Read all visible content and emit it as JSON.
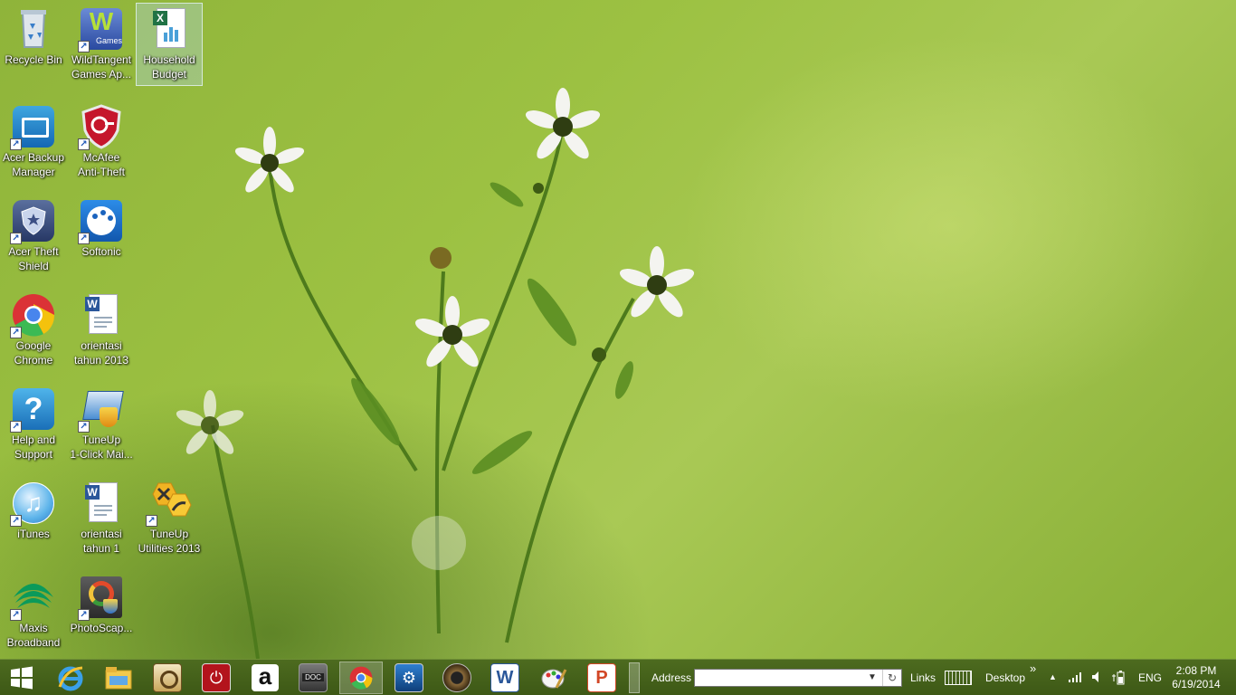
{
  "desktop": {
    "icons": [
      {
        "line1": "Recycle Bin",
        "line2": ""
      },
      {
        "line1": "WildTangent",
        "line2": "Games Ap..."
      },
      {
        "line1": "Household",
        "line2": "Budget"
      },
      {
        "line1": "Acer Backup",
        "line2": "Manager"
      },
      {
        "line1": "McAfee",
        "line2": "Anti-Theft"
      },
      {
        "line1": "Acer Theft",
        "line2": "Shield"
      },
      {
        "line1": "Softonic",
        "line2": ""
      },
      {
        "line1": "Google",
        "line2": "Chrome"
      },
      {
        "line1": "orientasi",
        "line2": "tahun 2013"
      },
      {
        "line1": "Help and",
        "line2": "Support"
      },
      {
        "line1": "TuneUp",
        "line2": "1-Click Mai..."
      },
      {
        "line1": "iTunes",
        "line2": ""
      },
      {
        "line1": "orientasi",
        "line2": "tahun 1"
      },
      {
        "line1": "TuneUp",
        "line2": "Utilities 2013"
      },
      {
        "line1": "Maxis",
        "line2": "Broadband"
      },
      {
        "line1": "PhotoScap...",
        "line2": ""
      }
    ],
    "wildtangent_badge": "Games"
  },
  "taskbar": {
    "address_label": "Address",
    "address_value": "",
    "links_label": "Links",
    "desktop_label": "Desktop",
    "chevron": "»",
    "language": "ENG",
    "time": "2:08 PM",
    "date": "6/19/2014",
    "pinned_icons": [
      "windows-start-icon",
      "internet-explorer-icon",
      "file-explorer-icon",
      "media-app-icon",
      "power-icon",
      "amazon-icon",
      "doc-viewer-icon",
      "chrome-icon",
      "settings-app-icon",
      "speaker-app-icon",
      "word-icon",
      "paint-icon",
      "powerpoint-icon"
    ],
    "amazon_letter": "a",
    "word_letter": "W",
    "powerpoint_letter": "P",
    "doc_label": "DOC"
  },
  "colors": {
    "taskbar": "#46621b",
    "accent_blue": "#1d55b5"
  }
}
